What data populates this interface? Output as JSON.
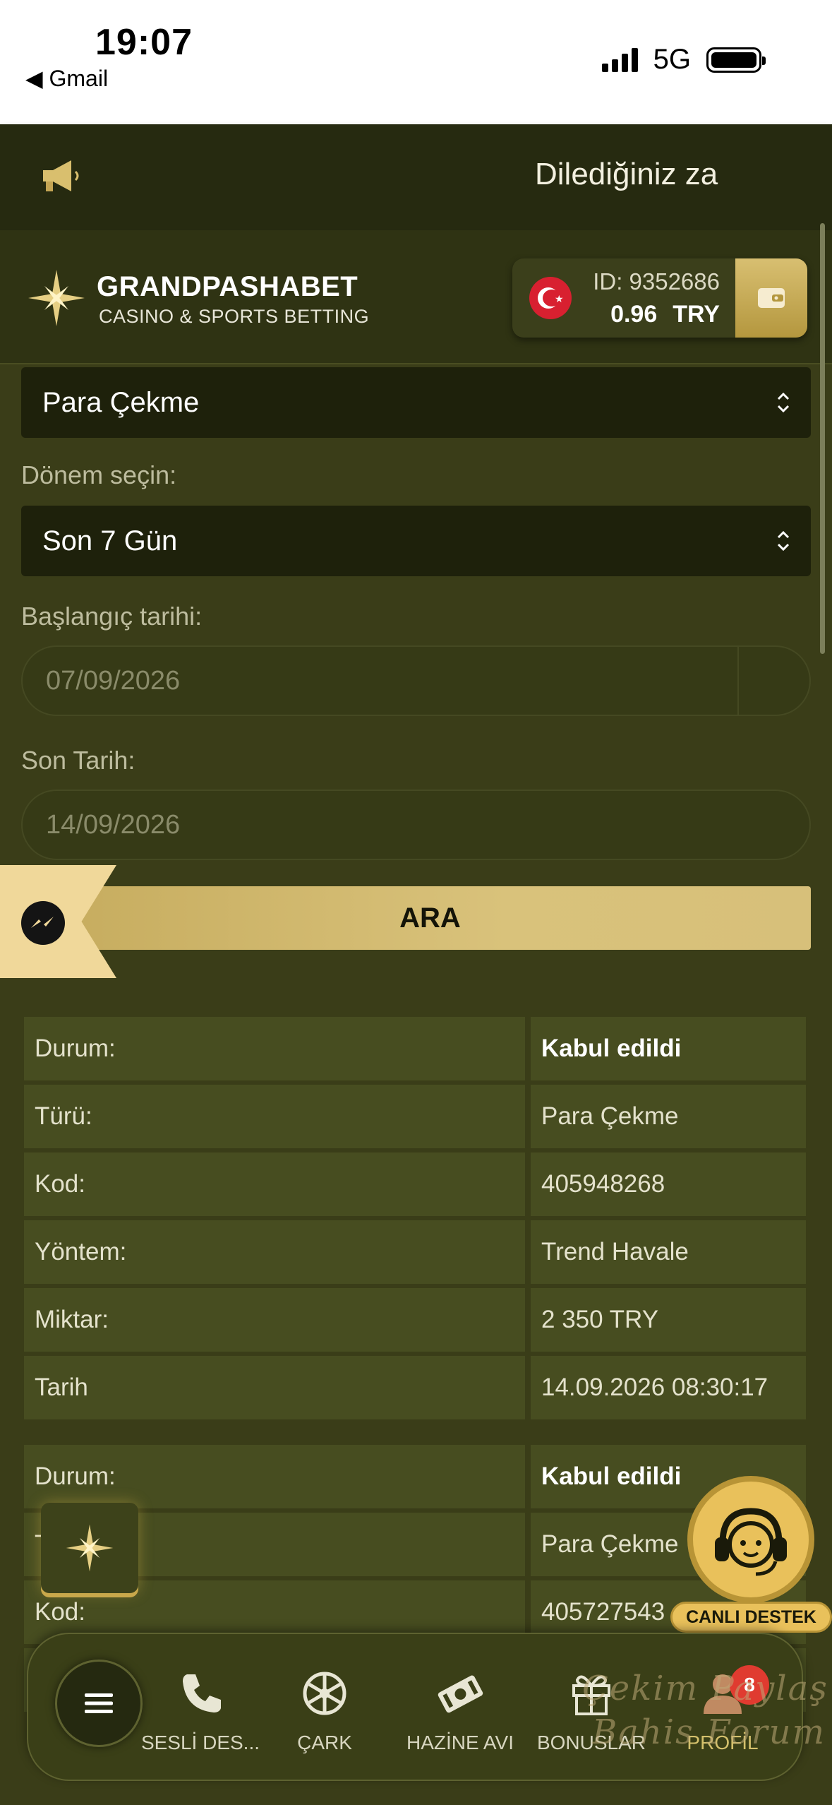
{
  "status_bar": {
    "time": "19:07",
    "back_app": "◀ Gmail",
    "network": "5G"
  },
  "announcement": {
    "text": "Dilediğiniz za"
  },
  "header": {
    "brand_name": "GRANDPASHABET",
    "brand_sub": "CASINO & SPORTS BETTING",
    "user_id": "ID: 9352686",
    "balance": "0.96",
    "currency": "TRY"
  },
  "form": {
    "type_select": "Para Çekme",
    "period_label": "Dönem seçin:",
    "period_select": "Son 7 Gün",
    "start_label": "Başlangıç tarihi:",
    "start_date": "07/09/2026",
    "end_label": "Son Tarih:",
    "end_date": "14/09/2026",
    "search_button": "ARA"
  },
  "transactions": [
    {
      "rows": [
        {
          "label": "Durum:",
          "value": "Kabul edildi",
          "bold": true
        },
        {
          "label": "Türü:",
          "value": "Para Çekme"
        },
        {
          "label": "Kod:",
          "value": "405948268"
        },
        {
          "label": "Yöntem:",
          "value": "Trend Havale"
        },
        {
          "label": "Miktar:",
          "value": "2 350 TRY"
        },
        {
          "label": "Tarih",
          "value": "14.09.2026 08:30:17"
        }
      ]
    },
    {
      "rows": [
        {
          "label": "Durum:",
          "value": "Kabul edildi",
          "bold": true
        },
        {
          "label": "T",
          "value": "Para Çekme"
        },
        {
          "label": "Kod:",
          "value": "405727543"
        }
      ]
    }
  ],
  "support": {
    "label": "CANLI DESTEK"
  },
  "bottom_nav": {
    "items": [
      {
        "label": "SESLİ DES...",
        "icon": "phone-icon"
      },
      {
        "label": "ÇARK",
        "icon": "wheel-icon"
      },
      {
        "label": "HAZİNE AVI",
        "icon": "ticket-icon"
      },
      {
        "label": "BONUSLAR",
        "icon": "gift-icon"
      },
      {
        "label": "PROFİL",
        "icon": "profile-icon"
      }
    ],
    "profile_badge": "8"
  },
  "watermark": {
    "line1": "Çekim Paylaş",
    "line2": "Bahis Forum"
  },
  "colors": {
    "accent_gold": "#d9c27b",
    "background": "#3a3d18",
    "header": "#2f3313",
    "badge_red": "#e03b30"
  }
}
